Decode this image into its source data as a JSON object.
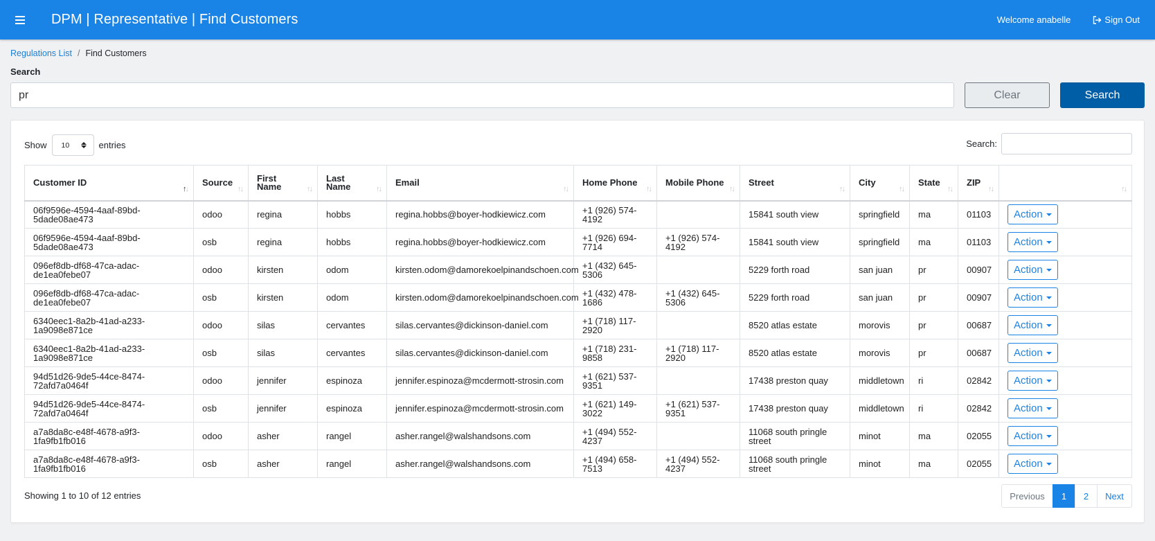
{
  "header": {
    "title": "DPM | Representative | Find Customers",
    "welcome": "Welcome anabelle",
    "signout": "Sign Out"
  },
  "breadcrumb": {
    "link": "Regulations List",
    "separator": "/",
    "current": "Find Customers"
  },
  "search": {
    "label": "Search",
    "value": "pr",
    "clear_label": "Clear",
    "search_label": "Search"
  },
  "table_controls": {
    "show_label": "Show",
    "length_value": "10",
    "entries_label": "entries",
    "filter_label": "Search:"
  },
  "table": {
    "columns": [
      {
        "key": "id",
        "label": "Customer ID"
      },
      {
        "key": "source",
        "label": "Source"
      },
      {
        "key": "first",
        "label": "First Name"
      },
      {
        "key": "last",
        "label": "Last Name"
      },
      {
        "key": "email",
        "label": "Email"
      },
      {
        "key": "home",
        "label": "Home Phone"
      },
      {
        "key": "mobile",
        "label": "Mobile Phone"
      },
      {
        "key": "street",
        "label": "Street"
      },
      {
        "key": "city",
        "label": "City"
      },
      {
        "key": "state",
        "label": "State"
      },
      {
        "key": "zip",
        "label": "ZIP"
      },
      {
        "key": "action",
        "label": ""
      }
    ],
    "action_label": "Action",
    "rows": [
      {
        "id": "06f9596e-4594-4aaf-89bd-5dade08ae473",
        "source": "odoo",
        "first": "regina",
        "last": "hobbs",
        "email": "regina.hobbs@boyer-hodkiewicz.com",
        "home": "+1 (926) 574-4192",
        "mobile": "",
        "street": "15841 south view",
        "city": "springfield",
        "state": "ma",
        "zip": "01103"
      },
      {
        "id": "06f9596e-4594-4aaf-89bd-5dade08ae473",
        "source": "osb",
        "first": "regina",
        "last": "hobbs",
        "email": "regina.hobbs@boyer-hodkiewicz.com",
        "home": "+1 (926) 694-7714",
        "mobile": "+1 (926) 574-4192",
        "street": "15841 south view",
        "city": "springfield",
        "state": "ma",
        "zip": "01103"
      },
      {
        "id": "096ef8db-df68-47ca-adac-de1ea0febe07",
        "source": "odoo",
        "first": "kirsten",
        "last": "odom",
        "email": "kirsten.odom@damorekoelpinandschoen.com",
        "home": "+1 (432) 645-5306",
        "mobile": "",
        "street": "5229 forth road",
        "city": "san juan",
        "state": "pr",
        "zip": "00907"
      },
      {
        "id": "096ef8db-df68-47ca-adac-de1ea0febe07",
        "source": "osb",
        "first": "kirsten",
        "last": "odom",
        "email": "kirsten.odom@damorekoelpinandschoen.com",
        "home": "+1 (432) 478-1686",
        "mobile": "+1 (432) 645-5306",
        "street": "5229 forth road",
        "city": "san juan",
        "state": "pr",
        "zip": "00907"
      },
      {
        "id": "6340eec1-8a2b-41ad-a233-1a9098e871ce",
        "source": "odoo",
        "first": "silas",
        "last": "cervantes",
        "email": "silas.cervantes@dickinson-daniel.com",
        "home": "+1 (718) 117-2920",
        "mobile": "",
        "street": "8520 atlas estate",
        "city": "morovis",
        "state": "pr",
        "zip": "00687"
      },
      {
        "id": "6340eec1-8a2b-41ad-a233-1a9098e871ce",
        "source": "osb",
        "first": "silas",
        "last": "cervantes",
        "email": "silas.cervantes@dickinson-daniel.com",
        "home": "+1 (718) 231-9858",
        "mobile": "+1 (718) 117-2920",
        "street": "8520 atlas estate",
        "city": "morovis",
        "state": "pr",
        "zip": "00687"
      },
      {
        "id": "94d51d26-9de5-44ce-8474-72afd7a0464f",
        "source": "odoo",
        "first": "jennifer",
        "last": "espinoza",
        "email": "jennifer.espinoza@mcdermott-strosin.com",
        "home": "+1 (621) 537-9351",
        "mobile": "",
        "street": "17438 preston quay",
        "city": "middletown",
        "state": "ri",
        "zip": "02842"
      },
      {
        "id": "94d51d26-9de5-44ce-8474-72afd7a0464f",
        "source": "osb",
        "first": "jennifer",
        "last": "espinoza",
        "email": "jennifer.espinoza@mcdermott-strosin.com",
        "home": "+1 (621) 149-3022",
        "mobile": "+1 (621) 537-9351",
        "street": "17438 preston quay",
        "city": "middletown",
        "state": "ri",
        "zip": "02842"
      },
      {
        "id": "a7a8da8c-e48f-4678-a9f3-1fa9fb1fb016",
        "source": "odoo",
        "first": "asher",
        "last": "rangel",
        "email": "asher.rangel@walshandsons.com",
        "home": "+1 (494) 552-4237",
        "mobile": "",
        "street": "11068 south pringle street",
        "city": "minot",
        "state": "ma",
        "zip": "02055"
      },
      {
        "id": "a7a8da8c-e48f-4678-a9f3-1fa9fb1fb016",
        "source": "osb",
        "first": "asher",
        "last": "rangel",
        "email": "asher.rangel@walshandsons.com",
        "home": "+1 (494) 658-7513",
        "mobile": "+1 (494) 552-4237",
        "street": "11068 south pringle street",
        "city": "minot",
        "state": "ma",
        "zip": "02055"
      }
    ]
  },
  "footer": {
    "info": "Showing 1 to 10 of 12 entries",
    "previous": "Previous",
    "page1": "1",
    "page2": "2",
    "next": "Next"
  }
}
